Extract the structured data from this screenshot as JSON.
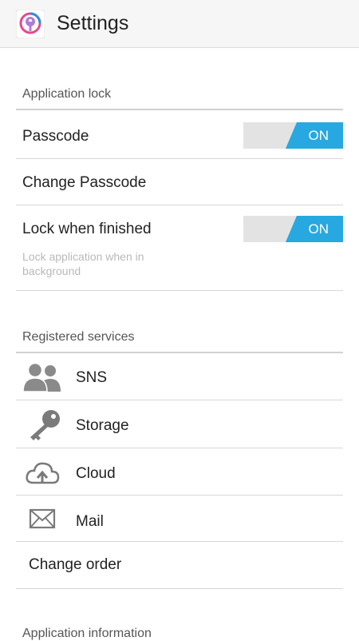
{
  "header": {
    "title": "Settings",
    "icon": "app-lock-icon"
  },
  "app_lock": {
    "section_title": "Application lock",
    "passcode": {
      "label": "Passcode",
      "toggle": "ON"
    },
    "change_passcode": "Change Passcode",
    "lock_when_finished": {
      "label": "Lock when finished",
      "toggle": "ON",
      "sublabel": "Lock application when in background"
    }
  },
  "registered_services": {
    "section_title": "Registered services",
    "items": [
      {
        "label": "SNS",
        "icon": "users-icon"
      },
      {
        "label": "Storage",
        "icon": "key-icon"
      },
      {
        "label": "Cloud",
        "icon": "cloud-upload-icon"
      },
      {
        "label": "Mail",
        "icon": "mail-icon"
      }
    ],
    "change_order": "Change order"
  },
  "app_info": {
    "section_title": "Application information"
  },
  "colors": {
    "accent": "#27a8e0",
    "toggle_off": "#e3e3e3"
  }
}
